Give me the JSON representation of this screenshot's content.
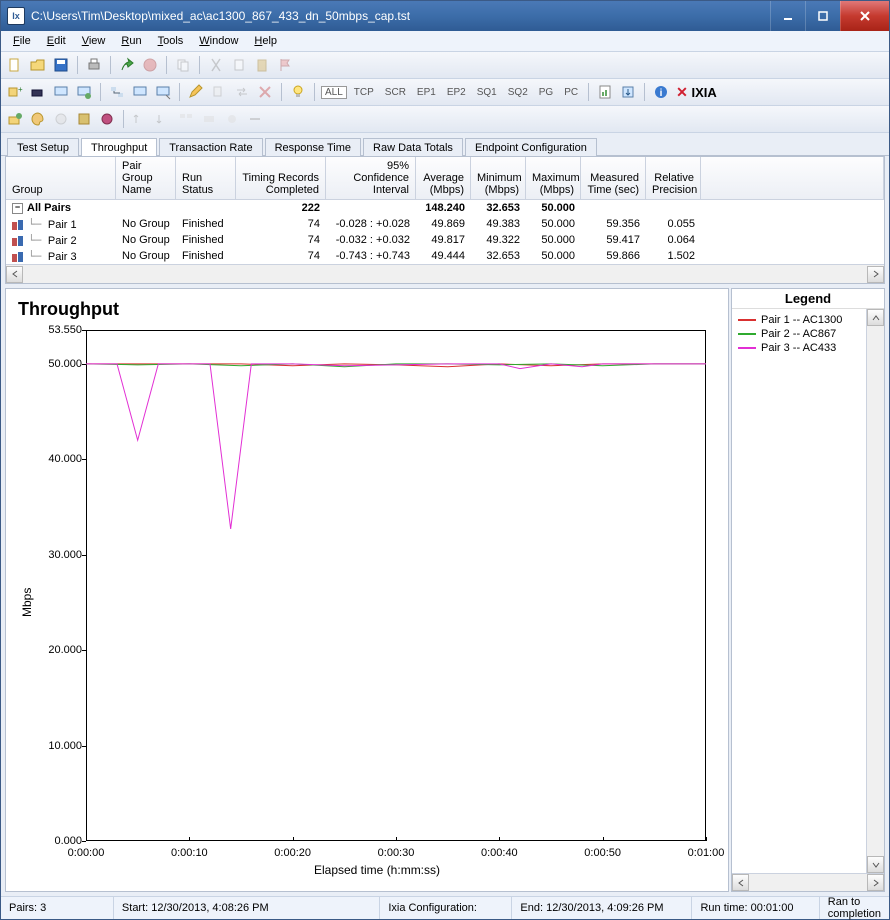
{
  "window": {
    "title": "C:\\Users\\Tim\\Desktop\\mixed_ac\\ac1300_867_433_dn_50mbps_cap.tst"
  },
  "menu": [
    "File",
    "Edit",
    "View",
    "Run",
    "Tools",
    "Window",
    "Help"
  ],
  "toolbar2_labels": {
    "all": "ALL",
    "tcp": "TCP",
    "scr": "SCR",
    "ep1": "EP1",
    "ep2": "EP2",
    "sq1": "SQ1",
    "sq2": "SQ2",
    "pg": "PG",
    "pc": "PC"
  },
  "brand": "IXIA",
  "tabs": [
    "Test Setup",
    "Throughput",
    "Transaction Rate",
    "Response Time",
    "Raw Data Totals",
    "Endpoint Configuration"
  ],
  "active_tab_index": 1,
  "table": {
    "headers": [
      "Group",
      "Pair Group\nName",
      "Run Status",
      "Timing Records\nCompleted",
      "95% Confidence\nInterval",
      "Average\n(Mbps)",
      "Minimum\n(Mbps)",
      "Maximum\n(Mbps)",
      "Measured\nTime (sec)",
      "Relative\nPrecision"
    ],
    "summary": {
      "label": "All Pairs",
      "timing": "222",
      "avg": "148.240",
      "min": "32.653",
      "max": "50.000"
    },
    "rows": [
      {
        "name": "Pair 1",
        "group": "No Group",
        "status": "Finished",
        "timing": "74",
        "ci": "-0.028 : +0.028",
        "avg": "49.869",
        "min": "49.383",
        "max": "50.000",
        "time": "59.356",
        "prec": "0.055"
      },
      {
        "name": "Pair 2",
        "group": "No Group",
        "status": "Finished",
        "timing": "74",
        "ci": "-0.032 : +0.032",
        "avg": "49.817",
        "min": "49.322",
        "max": "50.000",
        "time": "59.417",
        "prec": "0.064"
      },
      {
        "name": "Pair 3",
        "group": "No Group",
        "status": "Finished",
        "timing": "74",
        "ci": "-0.743 : +0.743",
        "avg": "49.444",
        "min": "32.653",
        "max": "50.000",
        "time": "59.866",
        "prec": "1.502"
      }
    ]
  },
  "chart_title": "Throughput",
  "chart_data": {
    "type": "line",
    "title": "Throughput",
    "xlabel": "Elapsed time (h:mm:ss)",
    "ylabel": "Mbps",
    "ylim": [
      0,
      53.55
    ],
    "yticks": [
      53.55,
      50.0,
      40.0,
      30.0,
      20.0,
      10.0,
      0.0
    ],
    "ytick_labels": [
      "53.550",
      "50.000",
      "40.000",
      "30.000",
      "20.000",
      "10.000",
      "0.000"
    ],
    "x_seconds": [
      0,
      10,
      20,
      30,
      40,
      50,
      60
    ],
    "xtick_labels": [
      "0:00:00",
      "0:00:10",
      "0:00:20",
      "0:00:30",
      "0:00:40",
      "0:00:50",
      "0:01:00"
    ],
    "series": [
      {
        "name": "Pair 1 -- AC1300",
        "color": "#d93030",
        "x": [
          0,
          5,
          10,
          15,
          20,
          25,
          30,
          35,
          40,
          45,
          50,
          55,
          60
        ],
        "y": [
          50.0,
          50.0,
          50.0,
          50.0,
          49.8,
          50.0,
          49.9,
          49.7,
          50.0,
          49.8,
          50.0,
          50.0,
          50.0
        ]
      },
      {
        "name": "Pair 2 -- AC867",
        "color": "#2faa2f",
        "x": [
          0,
          5,
          10,
          15,
          20,
          25,
          30,
          35,
          40,
          45,
          50,
          55,
          60
        ],
        "y": [
          50.0,
          49.9,
          50.0,
          49.8,
          50.0,
          49.7,
          50.0,
          50.0,
          49.9,
          50.0,
          49.8,
          50.0,
          50.0
        ]
      },
      {
        "name": "Pair 3 -- AC433",
        "color": "#e22fd4",
        "x": [
          0,
          3,
          5,
          7,
          10,
          12,
          14,
          16,
          18,
          20,
          25,
          30,
          35,
          40,
          42,
          45,
          48,
          50,
          55,
          60
        ],
        "y": [
          50.0,
          50.0,
          42.0,
          50.0,
          50.0,
          50.0,
          32.7,
          50.0,
          50.0,
          50.0,
          49.8,
          49.9,
          50.0,
          50.0,
          49.5,
          50.0,
          49.7,
          50.0,
          50.0,
          50.0
        ]
      }
    ]
  },
  "legend": {
    "title": "Legend",
    "items": [
      {
        "label": "Pair 1 -- AC1300",
        "color": "#d93030"
      },
      {
        "label": "Pair 2 -- AC867",
        "color": "#2faa2f"
      },
      {
        "label": "Pair 3 -- AC433",
        "color": "#e22fd4"
      }
    ]
  },
  "status": {
    "pairs": "Pairs: 3",
    "start": "Start: 12/30/2013, 4:08:26 PM",
    "config_label": "Ixia Configuration:",
    "end": "End: 12/30/2013, 4:09:26 PM",
    "runtime": "Run time: 00:01:00",
    "result": "Ran to completion"
  },
  "colors": {
    "series": [
      "#d93030",
      "#2faa2f",
      "#e22fd4"
    ]
  }
}
